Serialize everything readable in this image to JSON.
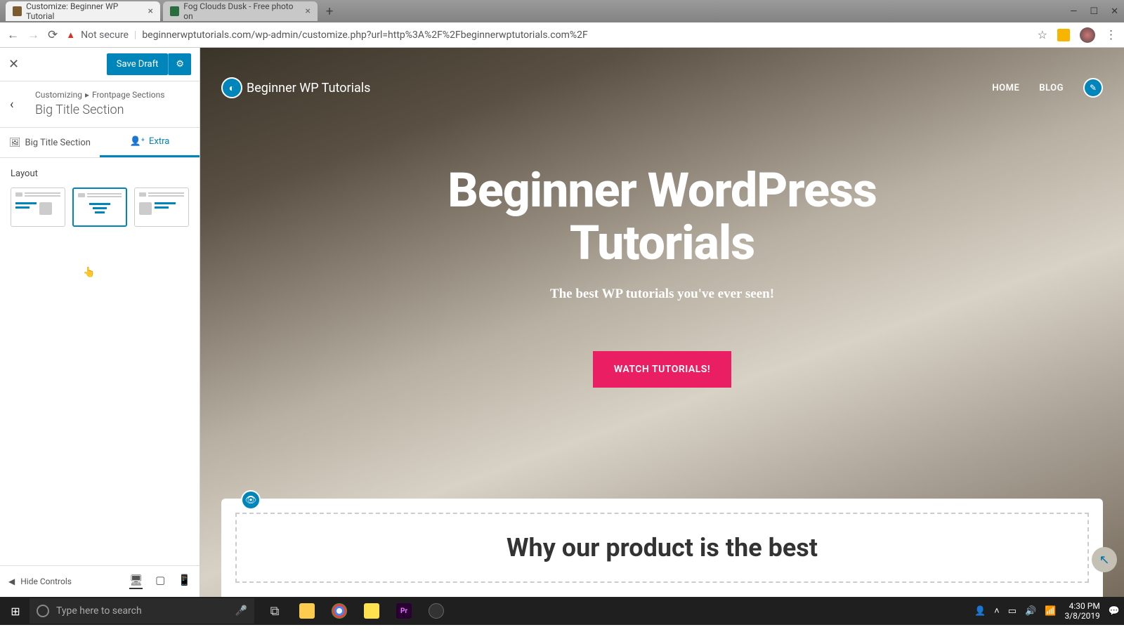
{
  "browser": {
    "tabs": [
      {
        "title": "Customize: Beginner WP Tutorial",
        "active": true
      },
      {
        "title": "Fog Clouds Dusk - Free photo on",
        "active": false
      }
    ],
    "url_warning": "Not secure",
    "url": "beginnerwptutorials.com/wp-admin/customize.php?url=http%3A%2F%2Fbeginnerwptutorials.com%2F"
  },
  "customizer": {
    "save_label": "Save Draft",
    "crumb_root": "Customizing",
    "crumb_parent": "Frontpage Sections",
    "section_title": "Big Title Section",
    "tabs": {
      "main": "Big Title Section",
      "extra": "Extra"
    },
    "layout_label": "Layout",
    "hide_controls": "Hide Controls"
  },
  "preview": {
    "site_name": "Beginner WP Tutorials",
    "nav": {
      "home": "HOME",
      "blog": "BLOG"
    },
    "hero_title_1": "Beginner WordPress",
    "hero_title_2": "Tutorials",
    "hero_sub": "The best WP tutorials you've ever seen!",
    "hero_cta": "WATCH TUTORIALS!",
    "section2_title": "Why our product is the best"
  },
  "taskbar": {
    "search_placeholder": "Type here to search",
    "time": "4:30 PM",
    "date": "3/8/2019"
  }
}
